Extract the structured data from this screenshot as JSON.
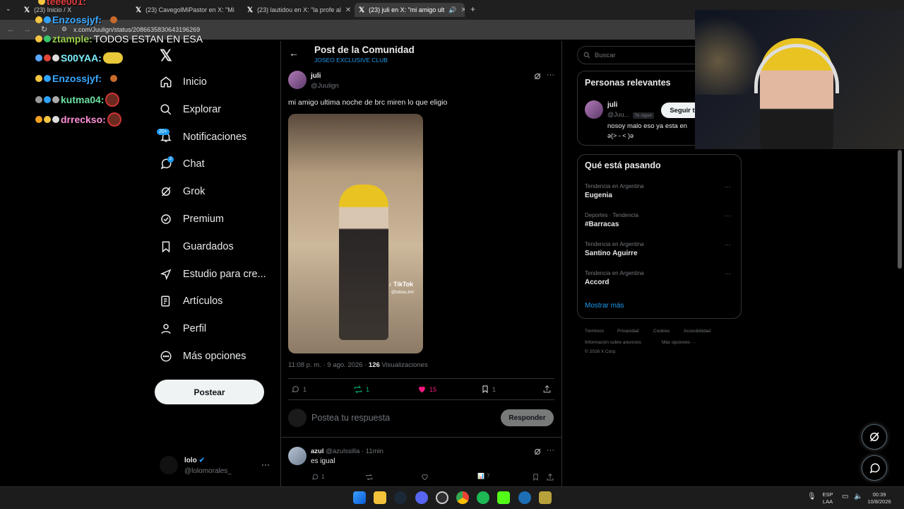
{
  "browser": {
    "tabs": [
      {
        "label": "(23) Inicio / X"
      },
      {
        "label": "(23) CavegolMiPastor en X: \"Mi"
      },
      {
        "label": "(23) lautidou en X: \"la profe al"
      },
      {
        "label": "(23) juli en X: \"mi amigo ult"
      }
    ],
    "url": "x.com/Juulign/status/2086635830643196269"
  },
  "chat_overlay": [
    {
      "user": "teee001:",
      "message": ""
    },
    {
      "user": "Enzossjyf:",
      "message": ""
    },
    {
      "user": "ztample:",
      "message": "TODOS ESTAN EN ESA"
    },
    {
      "user": "S00YAA:",
      "message": ""
    },
    {
      "user": "Enzossjyf:",
      "message": ""
    },
    {
      "user": "kutma04:",
      "message": ""
    },
    {
      "user": "drreckso:",
      "message": ""
    }
  ],
  "nav": {
    "items": [
      {
        "label": "Inicio",
        "icon": "home-icon"
      },
      {
        "label": "Explorar",
        "icon": "search-icon"
      },
      {
        "label": "Notificaciones",
        "icon": "bell-icon"
      },
      {
        "label": "Chat",
        "icon": "chat-icon"
      },
      {
        "label": "Grok",
        "icon": "grok-icon"
      },
      {
        "label": "Premium",
        "icon": "premium-icon"
      },
      {
        "label": "Guardados",
        "icon": "bookmark-icon"
      },
      {
        "label": "Estudio para cre...",
        "icon": "rocket-icon"
      },
      {
        "label": "Artículos",
        "icon": "article-icon"
      },
      {
        "label": "Perfil",
        "icon": "person-icon"
      },
      {
        "label": "Más opciones",
        "icon": "more-circle-icon"
      }
    ],
    "notif_badge": "20+",
    "chat_badge": "2",
    "post_button": "Postear",
    "profile": {
      "name": "lolo",
      "handle": "@lolomorales_"
    }
  },
  "post": {
    "header_title": "Post de la Comunidad",
    "community": "JOSEO EXCLUSIVE CLUB",
    "author_name": "juli",
    "author_handle": "@Juulign",
    "text": "mi amigo ultima noche de brc miren lo que eligio",
    "video_watermark": "TikTok",
    "video_handle": "@tobias.tml",
    "timestamp": "11:08 p. m. · 9 ago. 2026 ·",
    "views_count": "126",
    "views_label": "Visualizaciones",
    "stats": {
      "replies": "1",
      "reposts": "1",
      "likes": "15",
      "bookmarks": "1"
    },
    "reply_placeholder": "Postea tu respuesta",
    "reply_button": "Responder"
  },
  "reply": {
    "author_name": "azul",
    "author_handle": "@azulssilla",
    "time": "· 11min",
    "text": "es igual",
    "stats": {
      "replies": "1",
      "views": "7"
    }
  },
  "right": {
    "search_placeholder": "Buscar",
    "relevant_title": "Personas relevantes",
    "relevant_user": {
      "name": "juli",
      "handle": "@Juu...",
      "follows_you": "Te sigue",
      "follow_button": "Seguir t",
      "bio": "nosoy malo eso ya esta en",
      "bio2": "ə(> - < )ə"
    },
    "trends_title": "Qué está pasando",
    "trends": [
      {
        "category": "Tendencia en Argentina",
        "name": "Eugenia"
      },
      {
        "category": "Deportes · Tendencia",
        "name": "#Barracas"
      },
      {
        "category": "Tendencia en Argentina",
        "name": "Santino Aguirre"
      },
      {
        "category": "Tendencia en Argentina",
        "name": "Accord"
      }
    ],
    "show_more": "Mostrar más",
    "footer": {
      "terms": "Términos",
      "privacy": "Privacidad",
      "cookies": "Cookies",
      "accessibility": "Accesibilidad",
      "ads_info": "Información sobre anuncios",
      "more": "Más opciones ···",
      "copyright": "© 2026 X Corp."
    }
  },
  "taskbar": {
    "lang": "ESP",
    "lang2": "LAA",
    "time": "00:39",
    "date": "10/8/2026"
  },
  "colors": {
    "accent": "#1d9bf0",
    "like": "#f91880",
    "repost": "#00ba7c",
    "background": "#000000"
  }
}
